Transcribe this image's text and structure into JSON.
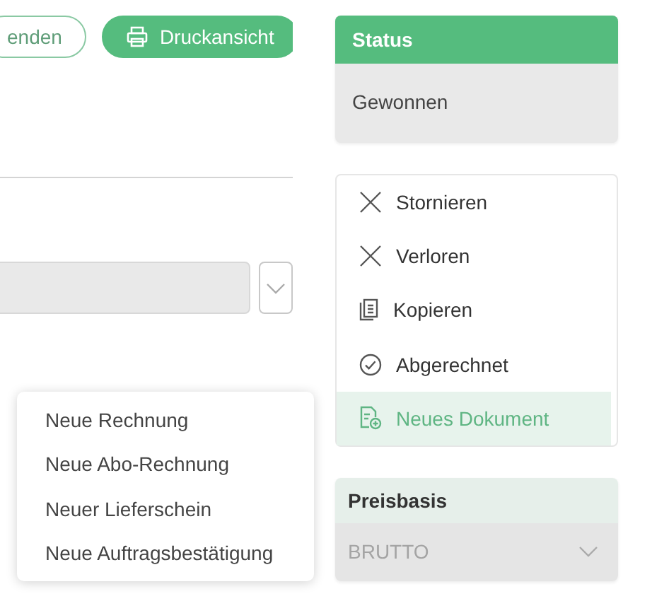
{
  "toolbar": {
    "buttons": [
      {
        "label": "enden",
        "kind": "outline"
      },
      {
        "label": "Druckansicht",
        "kind": "print"
      }
    ]
  },
  "popup_menu": {
    "items": [
      {
        "label": "Neue Rechnung"
      },
      {
        "label": "Neue Abo-Rechnung"
      },
      {
        "label": "Neuer Lieferschein"
      },
      {
        "label": "Neue Auftragsbestätigung"
      }
    ]
  },
  "status": {
    "title": "Status",
    "value": "Gewonnen"
  },
  "actions": [
    {
      "label": "Stornieren",
      "kind": "cross",
      "selected": false
    },
    {
      "label": "Verloren",
      "kind": "cross",
      "selected": false
    },
    {
      "label": "Kopieren",
      "kind": "copy",
      "selected": false
    },
    {
      "label": "Abgerechnet",
      "kind": "check",
      "selected": false
    },
    {
      "label": "Neues Dokument",
      "kind": "new-document",
      "selected": true
    }
  ],
  "price_basis": {
    "title": "Preisbasis",
    "value": "BRUTTO"
  }
}
